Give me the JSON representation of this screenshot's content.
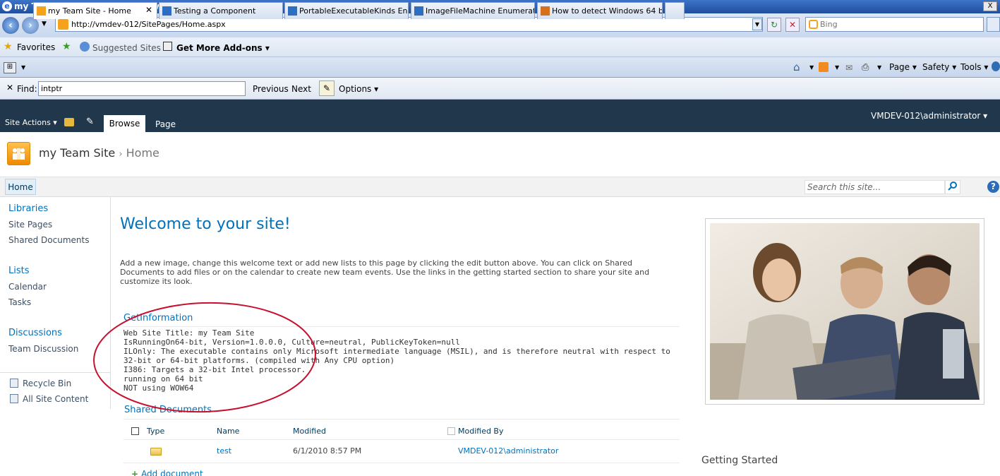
{
  "window": {
    "title": "my Team Site - Home - Windows Internet Explorer",
    "close": "X"
  },
  "address": {
    "url": "http://vmdev-012/SitePages/Home.aspx",
    "search_placeholder": "Bing"
  },
  "favorites_bar": {
    "favorites": "Favorites",
    "suggested": "Suggested Sites",
    "addons": "Get More Add-ons"
  },
  "tabs": [
    {
      "label": "my Team Site - Home"
    },
    {
      "label": "Testing a Component"
    },
    {
      "label": "PortableExecutableKinds En..."
    },
    {
      "label": "ImageFileMachine Enumerati..."
    },
    {
      "label": "How to detect Windows 64 b..."
    }
  ],
  "command_bar": {
    "page": "Page",
    "safety": "Safety",
    "tools": "Tools"
  },
  "find_bar": {
    "label": "Find:",
    "value": "intptr",
    "previous": "Previous",
    "next": "Next",
    "options": "Options"
  },
  "ribbon": {
    "site_actions": "Site Actions",
    "browse": "Browse",
    "page": "Page",
    "user": "VMDEV-012\\administrator"
  },
  "site": {
    "name": "my Team Site",
    "separator": "›",
    "page": "Home"
  },
  "topnav": {
    "home": "Home",
    "search_placeholder": "Search this site..."
  },
  "quicklaunch": {
    "libraries": "Libraries",
    "site_pages": "Site Pages",
    "shared_documents": "Shared Documents",
    "lists": "Lists",
    "calendar": "Calendar",
    "tasks": "Tasks",
    "discussions": "Discussions",
    "team_discussion": "Team Discussion",
    "recycle_bin": "Recycle Bin",
    "all_site_content": "All Site Content"
  },
  "main": {
    "welcome": "Welcome to your site!",
    "intro": "Add a new image, change this welcome text or add new lists to this page by clicking the edit button above. You can click on Shared Documents to add files or on the calendar to create new team events. Use the links in the getting started section to share your site and customize its look.",
    "getinfo_title": "GetInformation",
    "getinfo_lines": [
      "Web Site Title: my Team Site",
      "IsRunningOn64-bit, Version=1.0.0.0, Culture=neutral, PublicKeyToken=null",
      "ILOnly: The executable contains only Microsoft intermediate language (MSIL), and is therefore neutral with respect to 32-bit or 64-bit platforms. (compiled with Any CPU option)",
      "I386: Targets a 32-bit Intel processor.",
      "running on 64 bit",
      "NOT using WOW64"
    ],
    "shared_docs_title": "Shared Documents",
    "columns": {
      "type": "Type",
      "name": "Name",
      "modified": "Modified",
      "modified_by": "Modified By"
    },
    "rows": [
      {
        "name": "test",
        "modified": "6/1/2010 8:57 PM",
        "modified_by": "VMDEV-012\\administrator"
      }
    ],
    "add_document": "Add document",
    "getting_started": "Getting Started"
  },
  "colors": {
    "accent": "#0072bc",
    "ribbon": "#21374c",
    "annotation": "#c8102e"
  }
}
